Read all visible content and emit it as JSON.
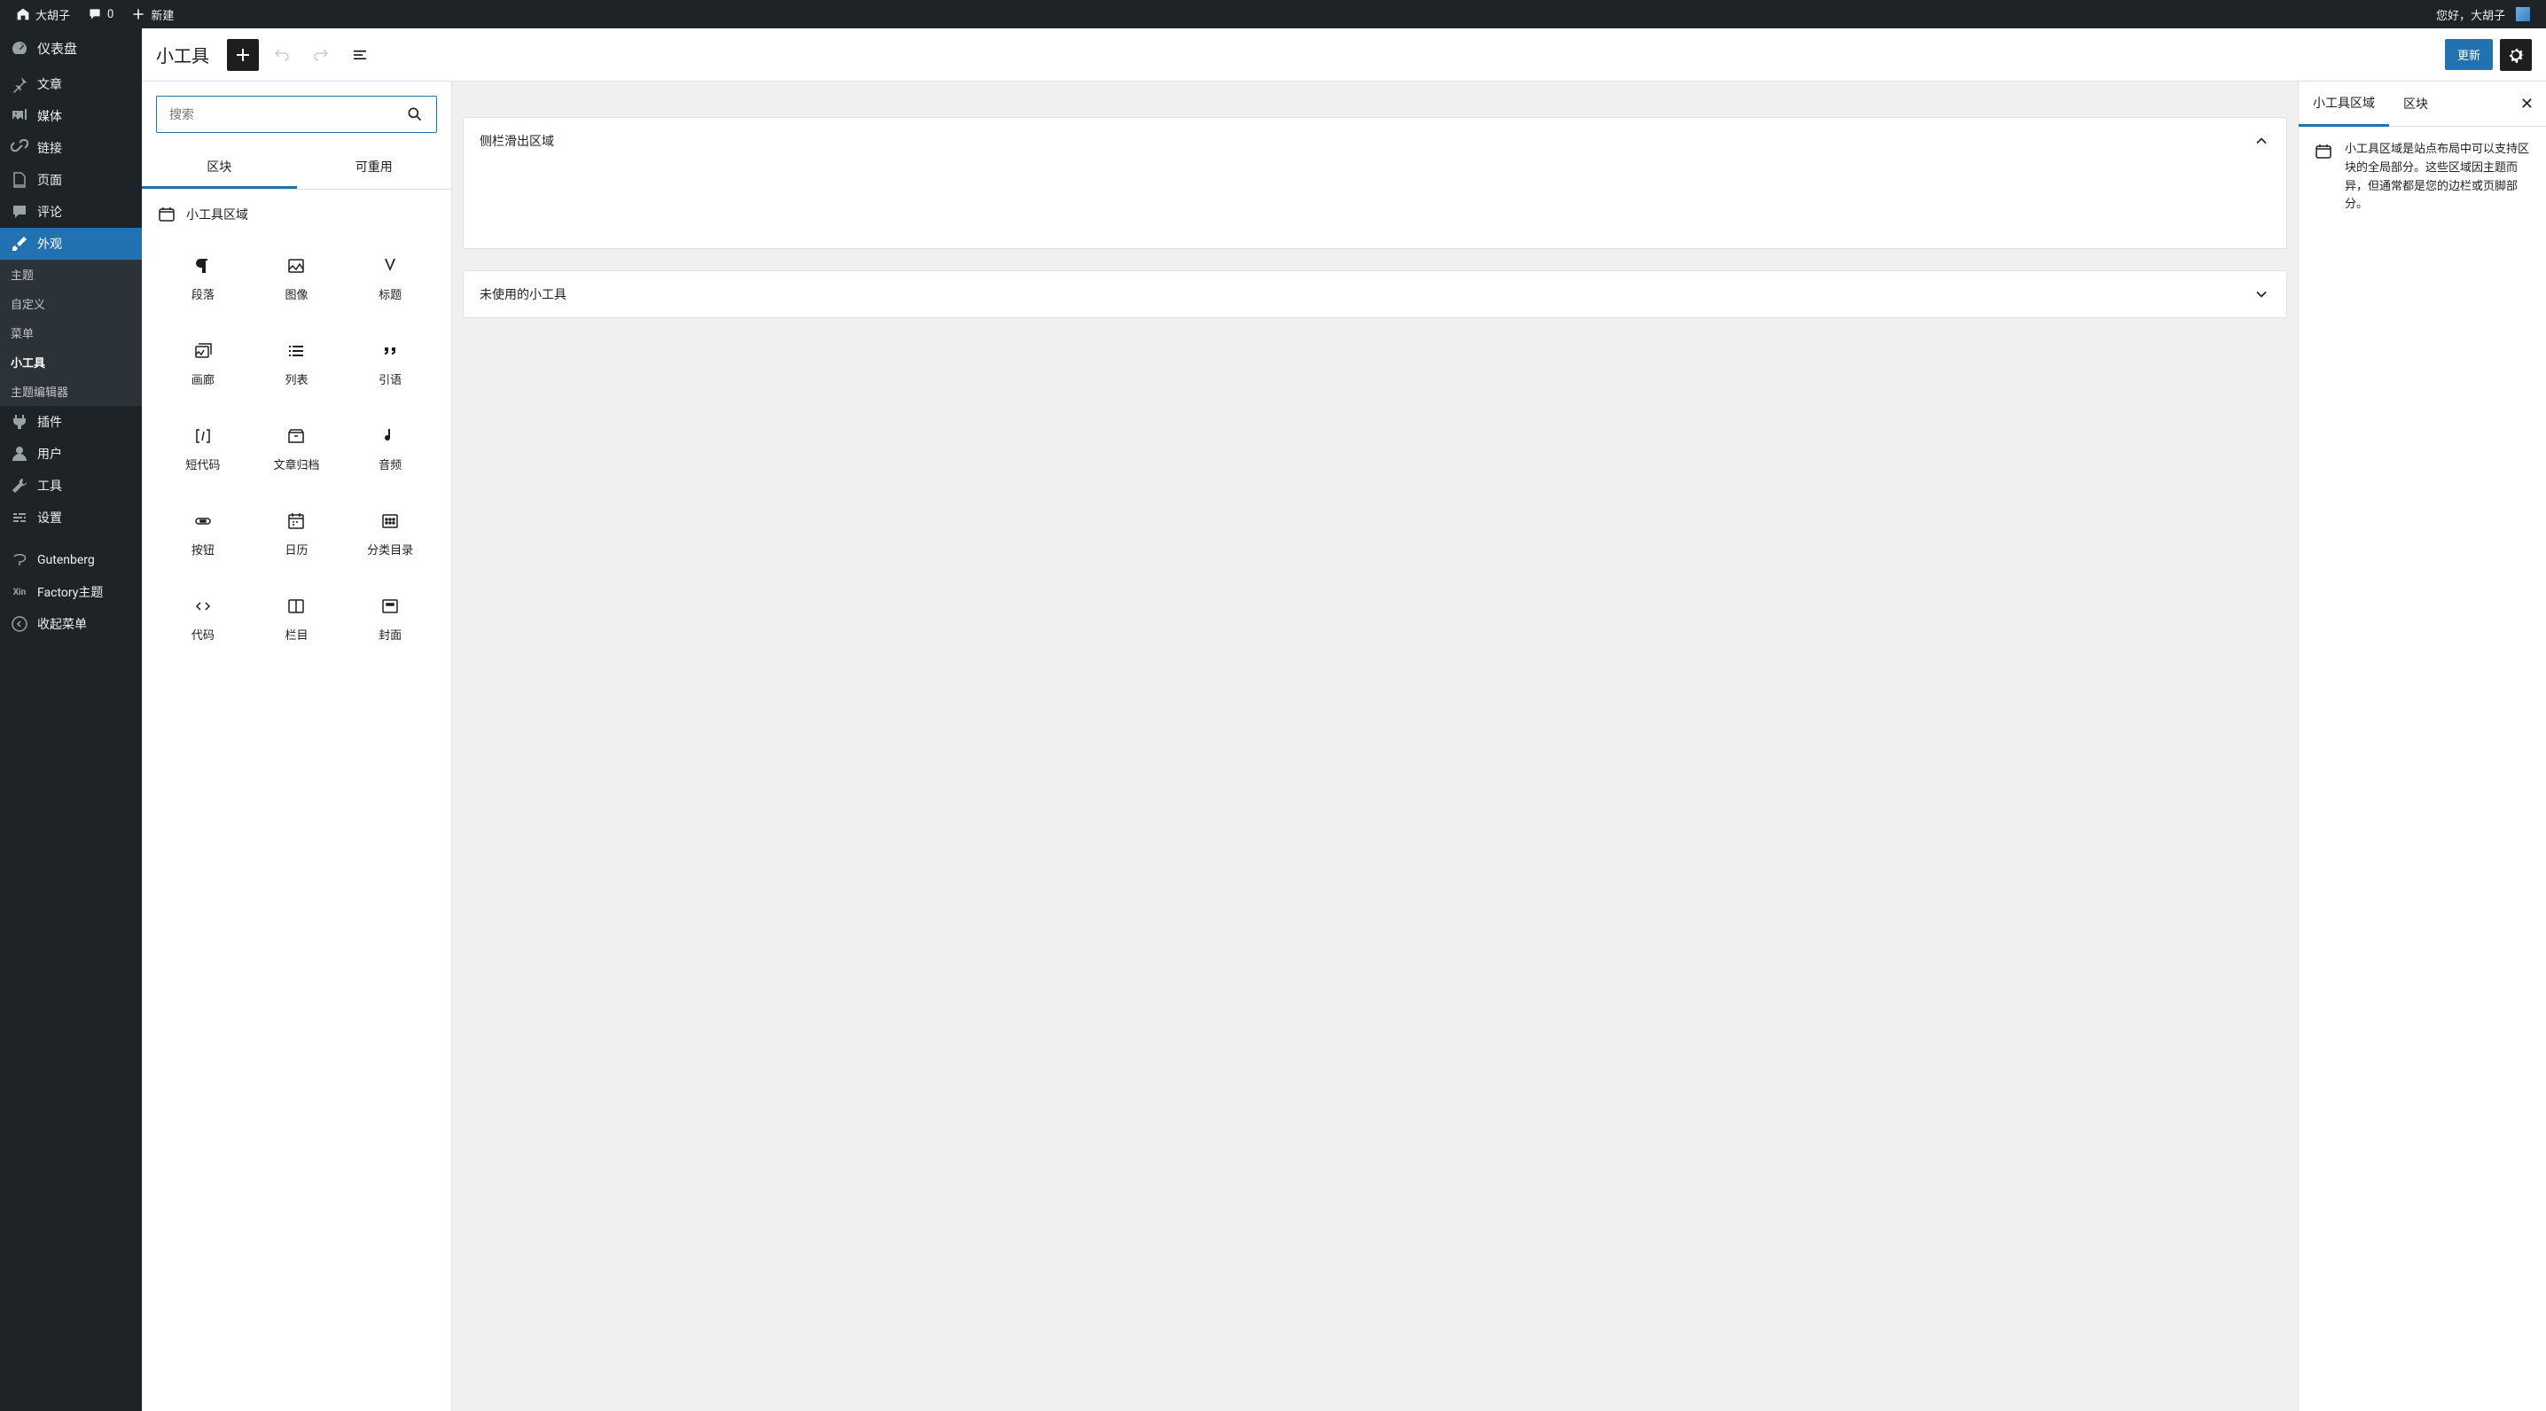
{
  "topbar": {
    "site_name": "大胡子",
    "comments_count": "0",
    "new_label": "新建",
    "greeting": "您好，大胡子"
  },
  "sidebar": {
    "items": [
      {
        "id": "dashboard",
        "label": "仪表盘"
      },
      {
        "id": "posts",
        "label": "文章"
      },
      {
        "id": "media",
        "label": "媒体"
      },
      {
        "id": "links",
        "label": "链接"
      },
      {
        "id": "pages",
        "label": "页面"
      },
      {
        "id": "comments",
        "label": "评论"
      },
      {
        "id": "appearance",
        "label": "外观"
      },
      {
        "id": "plugins",
        "label": "插件"
      },
      {
        "id": "users",
        "label": "用户"
      },
      {
        "id": "tools",
        "label": "工具"
      },
      {
        "id": "settings",
        "label": "设置"
      },
      {
        "id": "gutenberg",
        "label": "Gutenberg"
      },
      {
        "id": "factory",
        "label": "Factory主题"
      },
      {
        "id": "collapse",
        "label": "收起菜单"
      }
    ],
    "appearance_sub": [
      {
        "id": "themes",
        "label": "主题"
      },
      {
        "id": "customize",
        "label": "自定义"
      },
      {
        "id": "menus",
        "label": "菜单"
      },
      {
        "id": "widgets",
        "label": "小工具"
      },
      {
        "id": "theme_editor",
        "label": "主题编辑器"
      }
    ]
  },
  "editor": {
    "title": "小工具",
    "update_label": "更新"
  },
  "inserter": {
    "search_placeholder": "搜索",
    "tabs": {
      "blocks": "区块",
      "reusable": "可重用"
    },
    "category_widget_area": "小工具区域",
    "blocks": [
      {
        "id": "paragraph",
        "label": "段落"
      },
      {
        "id": "image",
        "label": "图像"
      },
      {
        "id": "heading",
        "label": "标题"
      },
      {
        "id": "gallery",
        "label": "画廊"
      },
      {
        "id": "list",
        "label": "列表"
      },
      {
        "id": "quote",
        "label": "引语"
      },
      {
        "id": "shortcode",
        "label": "短代码"
      },
      {
        "id": "archives",
        "label": "文章归档"
      },
      {
        "id": "audio",
        "label": "音频"
      },
      {
        "id": "button",
        "label": "按钮"
      },
      {
        "id": "calendar",
        "label": "日历"
      },
      {
        "id": "categories",
        "label": "分类目录"
      },
      {
        "id": "code",
        "label": "代码"
      },
      {
        "id": "columns",
        "label": "栏目"
      },
      {
        "id": "cover",
        "label": "封面"
      }
    ]
  },
  "canvas": {
    "areas": [
      {
        "name": "侧栏滑出区域",
        "expanded": true
      },
      {
        "name": "未使用的小工具",
        "expanded": false
      }
    ]
  },
  "settings": {
    "tabs": {
      "widget_area": "小工具区域",
      "block": "区块"
    },
    "description": "小工具区域是站点布局中可以支持区块的全局部分。这些区域因主题而异，但通常都是您的边栏或页脚部分。"
  }
}
